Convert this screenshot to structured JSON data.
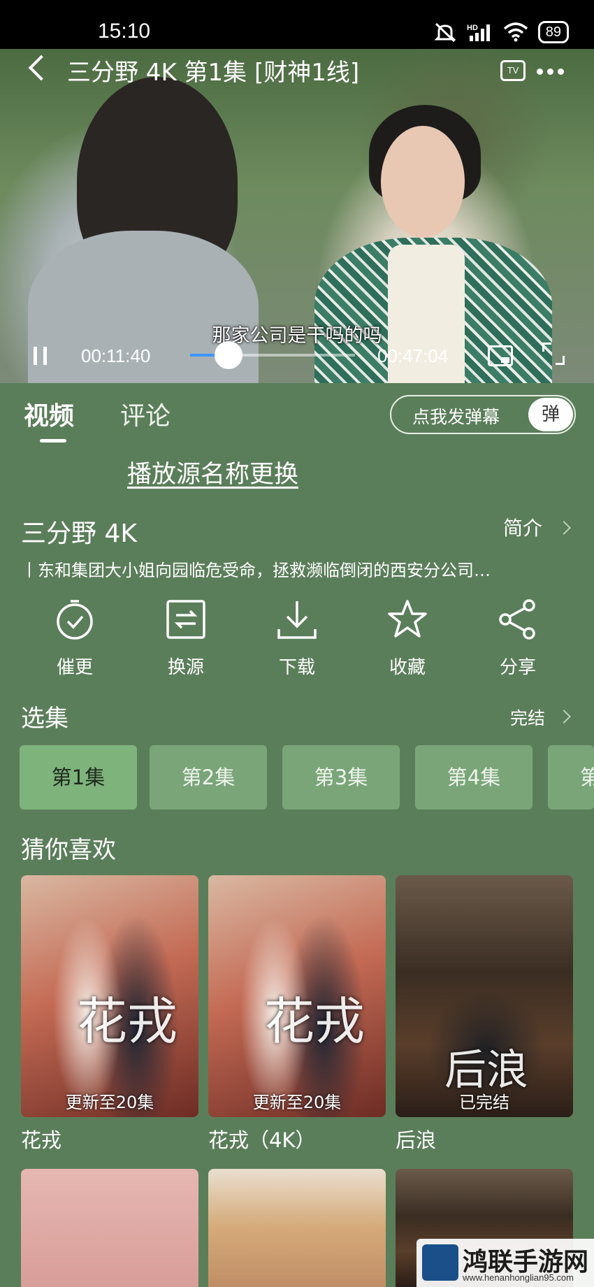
{
  "status": {
    "time": "15:10",
    "battery": "89"
  },
  "player": {
    "title": "三分野 4K 第1集 [财神1线]",
    "tv_label": "TV",
    "subtitle": "那家公司是干吗的吗",
    "current_time": "00:11:40",
    "duration": "00:47:04",
    "progress": 0.2
  },
  "tabs": {
    "video": "视频",
    "comments": "评论"
  },
  "danmaku": {
    "label": "点我发弹幕",
    "button": "弹"
  },
  "source_link": "播放源名称更换",
  "show": {
    "title": "三分野 4K",
    "intro_label": "简介",
    "description": "丨东和集团大小姐向园临危受命，拯救濒临倒闭的西安分公司…"
  },
  "actions": [
    "催更",
    "换源",
    "下载",
    "收藏",
    "分享"
  ],
  "episodes": {
    "heading": "选集",
    "status": "完结",
    "items": [
      "第1集",
      "第2集",
      "第3集",
      "第4集",
      "第"
    ]
  },
  "recommend": {
    "heading": "猜你喜欢",
    "items": [
      {
        "name": "花戎",
        "badge": "更新至20集",
        "poster_char": "花戎"
      },
      {
        "name": "花戎（4K）",
        "badge": "更新至20集",
        "poster_char": "花戎"
      },
      {
        "name": "后浪",
        "badge": "已完结",
        "poster_char": "后浪"
      }
    ]
  },
  "watermark": {
    "title": "鸿联手游网",
    "url": "www.henanhonglian95.com"
  }
}
